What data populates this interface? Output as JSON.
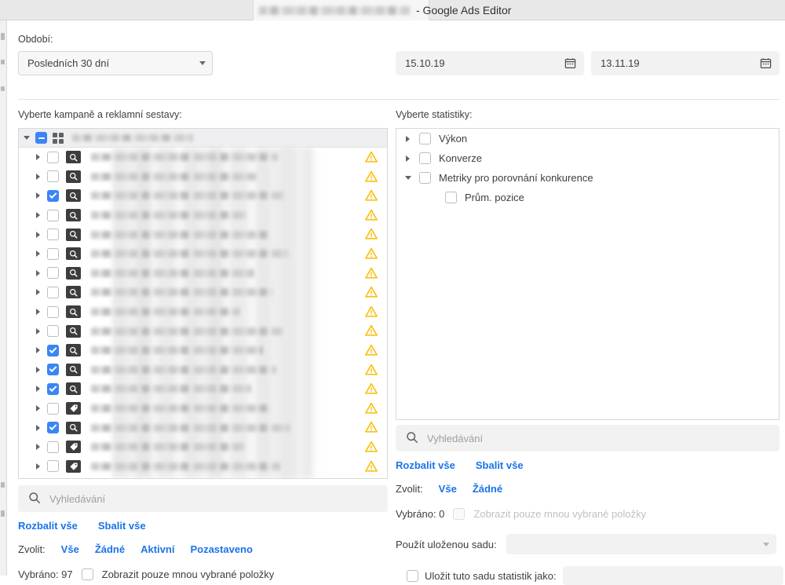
{
  "window": {
    "title_suffix": "- Google Ads Editor",
    "account_redacted": true
  },
  "period": {
    "label": "Období:",
    "select_value": "Posledních 30 dní",
    "date_start": "15.10.19",
    "date_end": "13.11.19",
    "calendar_icon": "calendar-icon",
    "caret_icon": "chevron-down-icon"
  },
  "left_panel": {
    "heading": "Vyberte kampaně a reklamní sestavy:",
    "header_row": {
      "expand_icon": "chevron-down-icon",
      "checkbox_state": "indeterminate",
      "grid_icon": "grid-icon",
      "name_redacted": true
    },
    "rows": [
      {
        "checked": false,
        "icon": "magnifier-icon",
        "warning": true,
        "name_width": 238
      },
      {
        "checked": false,
        "icon": "magnifier-icon",
        "warning": true,
        "name_width": 212
      },
      {
        "checked": true,
        "icon": "magnifier-icon",
        "warning": true,
        "name_width": 246
      },
      {
        "checked": false,
        "icon": "magnifier-icon",
        "warning": true,
        "name_width": 198
      },
      {
        "checked": false,
        "icon": "magnifier-icon",
        "warning": true,
        "name_width": 226
      },
      {
        "checked": false,
        "icon": "magnifier-icon",
        "warning": true,
        "name_width": 251
      },
      {
        "checked": false,
        "icon": "magnifier-icon",
        "warning": true,
        "name_width": 208
      },
      {
        "checked": false,
        "icon": "magnifier-icon",
        "warning": true,
        "name_width": 232
      },
      {
        "checked": false,
        "icon": "magnifier-icon",
        "warning": true,
        "name_width": 190
      },
      {
        "checked": false,
        "icon": "magnifier-icon",
        "warning": true,
        "name_width": 244
      },
      {
        "checked": true,
        "icon": "magnifier-icon",
        "warning": true,
        "name_width": 219
      },
      {
        "checked": true,
        "icon": "magnifier-icon",
        "warning": true,
        "name_width": 236
      },
      {
        "checked": true,
        "icon": "magnifier-icon",
        "warning": true,
        "name_width": 204
      },
      {
        "checked": false,
        "icon": "tag-icon",
        "warning": true,
        "name_width": 228
      },
      {
        "checked": true,
        "icon": "magnifier-icon",
        "warning": true,
        "name_width": 253
      },
      {
        "checked": false,
        "icon": "tag-icon",
        "warning": true,
        "name_width": 196
      },
      {
        "checked": false,
        "icon": "tag-icon",
        "warning": true,
        "name_width": 241
      }
    ],
    "search_placeholder": "Vyhledávání",
    "search_value": "",
    "expand_all": "Rozbalit vše",
    "collapse_all": "Sbalit vše",
    "choose_label": "Zvolit:",
    "choose_options": [
      "Vše",
      "Žádné",
      "Aktivní",
      "Pozastaveno"
    ],
    "selected_text": "Vybráno: 97",
    "show_selected_only": "Zobrazit pouze mnou vybrané položky",
    "show_selected_only_checked": false,
    "show_selected_only_disabled": false
  },
  "right_panel": {
    "heading": "Vyberte statistiky:",
    "metrics": [
      {
        "label": "Výkon",
        "expanded": false,
        "checked": false,
        "has_arrow": true,
        "child": false
      },
      {
        "label": "Konverze",
        "expanded": false,
        "checked": false,
        "has_arrow": true,
        "child": false
      },
      {
        "label": "Metriky pro porovnání konkurence",
        "expanded": true,
        "checked": false,
        "has_arrow": true,
        "child": false
      },
      {
        "label": "Prům. pozice",
        "expanded": false,
        "checked": false,
        "has_arrow": false,
        "child": true
      }
    ],
    "search_placeholder": "Vyhledávání",
    "search_value": "",
    "expand_all": "Rozbalit vše",
    "collapse_all": "Sbalit vše",
    "choose_label": "Zvolit:",
    "choose_options": [
      "Vše",
      "Žádné"
    ],
    "selected_text": "Vybráno: 0",
    "show_selected_only": "Zobrazit pouze mnou vybrané položky",
    "show_selected_only_checked": false,
    "show_selected_only_disabled": true,
    "saved_set_label": "Použít uloženou sadu:",
    "saved_set_value": "",
    "save_as_label": "Uložit tuto sadu statistik jako:",
    "save_as_checked": false,
    "save_as_value": ""
  },
  "colors": {
    "accent_blue": "#1a73e8",
    "checkbox_blue": "#3b85f5",
    "warning_amber": "#fbbc04",
    "panel_border": "#d8d8d8",
    "field_bg": "#f2f2f2"
  },
  "icons": {
    "search": "search-icon",
    "warning": "warning-triangle-icon",
    "magnifier": "magnifier-icon",
    "tag": "tag-icon",
    "calendar": "calendar-icon",
    "grid": "grid-icon"
  }
}
